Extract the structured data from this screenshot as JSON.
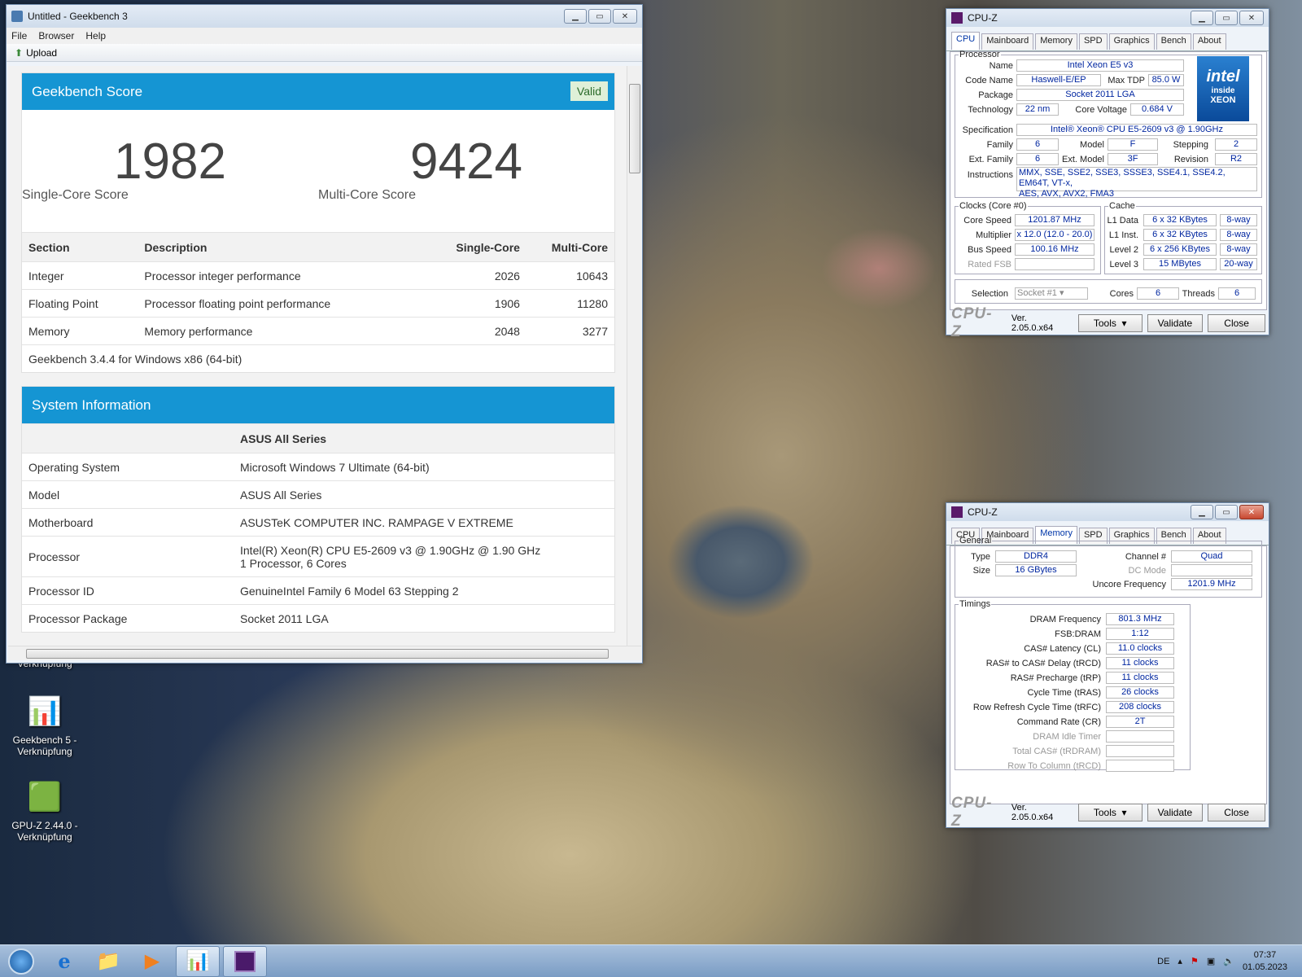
{
  "geekbench": {
    "title": "Untitled - Geekbench 3",
    "menu": [
      "File",
      "Browser",
      "Help"
    ],
    "upload": "Upload",
    "score_panel": {
      "title": "Geekbench Score",
      "valid": "Valid",
      "single": "1982",
      "single_label": "Single-Core Score",
      "multi": "9424",
      "multi_label": "Multi-Core Score",
      "headers": [
        "Section",
        "Description",
        "Single-Core",
        "Multi-Core"
      ],
      "rows": [
        [
          "Integer",
          "Processor integer performance",
          "2026",
          "10643"
        ],
        [
          "Floating Point",
          "Processor floating point performance",
          "1906",
          "11280"
        ],
        [
          "Memory",
          "Memory performance",
          "2048",
          "3277"
        ]
      ],
      "footer": "Geekbench 3.4.4 for Windows x86 (64-bit)"
    },
    "sys_panel": {
      "title": "System Information",
      "header": "ASUS All Series",
      "rows": [
        [
          "Operating System",
          "Microsoft Windows 7 Ultimate (64-bit)",
          ""
        ],
        [
          "Model",
          "ASUS All Series",
          ""
        ],
        [
          "Motherboard",
          "ASUSTeK COMPUTER INC. RAMPAGE V EXTREME",
          ""
        ],
        [
          "Processor",
          "Intel(R) Xeon(R) CPU E5-2609 v3 @ 1.90GHz @ 1.90 GHz",
          "1 Processor, 6 Cores"
        ],
        [
          "Processor ID",
          "GenuineIntel Family 6 Model 63 Stepping 2",
          ""
        ],
        [
          "Processor Package",
          "Socket 2011 LGA",
          ""
        ]
      ]
    }
  },
  "cpuz_common": {
    "title": "CPU-Z",
    "tabs": [
      "CPU",
      "Mainboard",
      "Memory",
      "SPD",
      "Graphics",
      "Bench",
      "About"
    ],
    "logo": "CPU-Z",
    "version": "Ver. 2.05.0.x64",
    "tools": "Tools",
    "validate": "Validate",
    "close": "Close"
  },
  "cpuz_cpu": {
    "processor_legend": "Processor",
    "name_l": "Name",
    "name": "Intel Xeon E5 v3",
    "codename_l": "Code Name",
    "codename": "Haswell-E/EP",
    "maxtdp_l": "Max TDP",
    "maxtdp": "85.0 W",
    "package_l": "Package",
    "package": "Socket 2011 LGA",
    "tech_l": "Technology",
    "tech": "22 nm",
    "cv_l": "Core Voltage",
    "cv": "0.684 V",
    "spec_l": "Specification",
    "spec": "Intel® Xeon® CPU E5-2609 v3 @ 1.90GHz",
    "family_l": "Family",
    "family": "6",
    "model_l": "Model",
    "model": "F",
    "stepping_l": "Stepping",
    "stepping": "2",
    "extfam_l": "Ext. Family",
    "extfam": "6",
    "extmod_l": "Ext. Model",
    "extmod": "3F",
    "rev_l": "Revision",
    "rev": "R2",
    "instr_l": "Instructions",
    "instr1": "MMX, SSE, SSE2, SSE3, SSSE3, SSE4.1, SSE4.2, EM64T, VT-x,",
    "instr2": "AES, AVX, AVX2, FMA3",
    "clocks_legend": "Clocks (Core #0)",
    "cs_l": "Core Speed",
    "cs": "1201.87 MHz",
    "mul_l": "Multiplier",
    "mul": "x 12.0 (12.0 - 20.0)",
    "bus_l": "Bus Speed",
    "bus": "100.16 MHz",
    "fsb_l": "Rated FSB",
    "cache_legend": "Cache",
    "l1d_l": "L1 Data",
    "l1d": "6 x 32 KBytes",
    "l1d_w": "8-way",
    "l1i_l": "L1 Inst.",
    "l1i": "6 x 32 KBytes",
    "l1i_w": "8-way",
    "l2_l": "Level 2",
    "l2": "6 x 256 KBytes",
    "l2_w": "8-way",
    "l3_l": "Level 3",
    "l3": "15 MBytes",
    "l3_w": "20-way",
    "sel_l": "Selection",
    "sel": "Socket #1",
    "cores_l": "Cores",
    "cores": "6",
    "threads_l": "Threads",
    "threads": "6",
    "intel_logo": [
      "intel",
      "inside",
      "XEON"
    ]
  },
  "cpuz_mem": {
    "general_legend": "General",
    "type_l": "Type",
    "type": "DDR4",
    "size_l": "Size",
    "size": "16 GBytes",
    "ch_l": "Channel #",
    "ch": "Quad",
    "dc_l": "DC Mode",
    "uf_l": "Uncore Frequency",
    "uf": "1201.9 MHz",
    "timings_legend": "Timings",
    "timings": [
      [
        "DRAM Frequency",
        "801.3 MHz"
      ],
      [
        "FSB:DRAM",
        "1:12"
      ],
      [
        "CAS# Latency (CL)",
        "11.0 clocks"
      ],
      [
        "RAS# to CAS# Delay (tRCD)",
        "11 clocks"
      ],
      [
        "RAS# Precharge (tRP)",
        "11 clocks"
      ],
      [
        "Cycle Time (tRAS)",
        "26 clocks"
      ],
      [
        "Row Refresh Cycle Time (tRFC)",
        "208 clocks"
      ],
      [
        "Command Rate (CR)",
        "2T"
      ],
      [
        "DRAM Idle Timer",
        ""
      ],
      [
        "Total CAS# (tRDRAM)",
        ""
      ],
      [
        "Row To Column (tRCD)",
        ""
      ]
    ]
  },
  "desktop": {
    "icons": [
      {
        "label1": "Verknüpfung",
        "label2": ""
      },
      {
        "label1": "Geekbench 5 -",
        "label2": "Verknüpfung"
      },
      {
        "label1": "GPU-Z 2.44.0 -",
        "label2": "Verknüpfung"
      }
    ]
  },
  "taskbar": {
    "lang": "DE",
    "time": "07:37",
    "date": "01.05.2023"
  },
  "colors": {
    "accent": "#1595d3",
    "valid_bg": "#dff0d8",
    "cpuz_value": "#0026a0"
  }
}
